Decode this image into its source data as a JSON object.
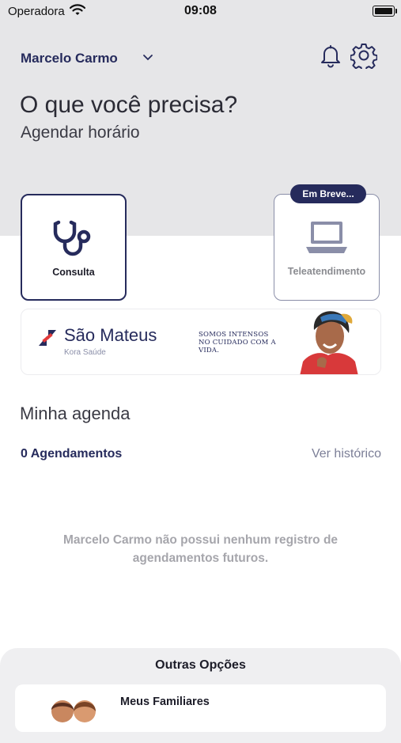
{
  "status_bar": {
    "carrier": "Operadora",
    "time": "09:08"
  },
  "header": {
    "user_name": "Marcelo Carmo"
  },
  "hero": {
    "question": "O que você precisa?",
    "subtitle": "Agendar horário"
  },
  "services": [
    {
      "label": "Consulta",
      "icon": "stethoscope-icon",
      "enabled": true
    },
    {
      "label": "Teleatendimento",
      "icon": "laptop-icon",
      "enabled": false,
      "badge": "Em Breve..."
    }
  ],
  "banner": {
    "brand": "São Mateus",
    "sub": "Kora Saúde",
    "tagline": "SOMOS INTENSOS NO CUIDADO COM A VIDA."
  },
  "agenda": {
    "title": "Minha agenda",
    "count_label": "0 Agendamentos",
    "history_link": "Ver histórico",
    "empty_message": "Marcelo Carmo não possui nenhum registro de agendamentos futuros."
  },
  "other_options": {
    "title": "Outras Opções",
    "items": [
      {
        "label": "Meus Familiares",
        "icon": "family-icon"
      }
    ]
  },
  "colors": {
    "primary": "#262b5c",
    "header_bg": "#e6e6e8",
    "muted": "#a6a6ac"
  }
}
